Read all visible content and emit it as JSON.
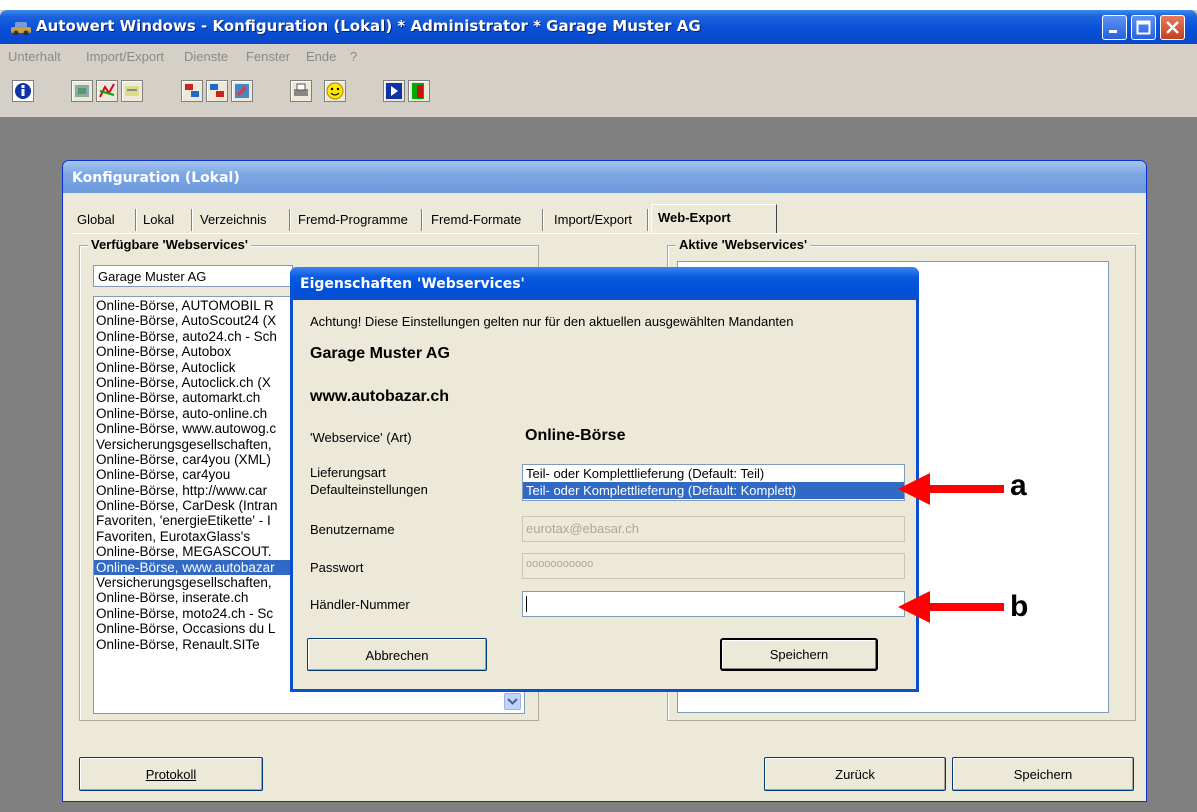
{
  "app": {
    "title": "Autowert Windows - Konfiguration (Lokal) * Administrator * Garage Muster AG",
    "menu": [
      "Unterhalt",
      "Import/Export",
      "Dienste",
      "Fenster",
      "Ende",
      "?"
    ]
  },
  "config_window": {
    "title": "Konfiguration (Lokal)",
    "tabs": [
      "Global",
      "Lokal",
      "Verzeichnis",
      "Fremd-Programme",
      "Fremd-Formate",
      "Import/Export",
      "Web-Export"
    ],
    "active_tab": "Web-Export",
    "available_group": {
      "legend": "Verfügbare 'Webservices'",
      "combo_value": "Garage Muster AG",
      "items": [
        "Online-Börse, AUTOMOBIL R",
        "Online-Börse, AutoScout24 (X",
        "Online-Börse, auto24.ch - Sch",
        "Online-Börse, Autobox",
        "Online-Börse, Autoclick",
        "Online-Börse, Autoclick.ch (X",
        "Online-Börse, automarkt.ch",
        "Online-Börse, auto-online.ch",
        "Online-Börse, www.autowog.c",
        "Versicherungsgesellschaften,",
        "Online-Börse, car4you (XML)",
        "Online-Börse, car4you",
        "Online-Börse, http://www.car",
        "Online-Börse, CarDesk (Intran",
        "Favoriten, 'energieEtikette' - I",
        "Favoriten, EurotaxGlass's",
        "Online-Börse, MEGASCOUT.",
        "Online-Börse, www.autobazar",
        "Versicherungsgesellschaften,",
        "Online-Börse, inserate.ch",
        "Online-Börse, moto24.ch - Sc",
        "Online-Börse, Occasions du L",
        "Online-Börse, Renault.SITe"
      ],
      "selected_index": 17
    },
    "active_group": {
      "legend": "Aktive 'Webservices'"
    },
    "buttons": {
      "protokoll": "Protokoll",
      "zurueck": "Zurück",
      "speichern": "Speichern"
    }
  },
  "dialog": {
    "title": "Eigenschaften 'Webservices'",
    "notice": "Achtung! Diese Einstellungen gelten nur für den aktuellen ausgewählten Mandanten",
    "company": "Garage Muster AG",
    "service_url": "www.autobazar.ch",
    "type_label": "'Webservice' (Art)",
    "type_value": "Online-Börse",
    "delivery_label_1": "Lieferungsart",
    "delivery_label_2": "Defaulteinstellungen",
    "delivery_options": [
      "Teil- oder Komplettlieferung (Default: Teil)",
      "Teil- oder Komplettlieferung (Default: Komplett)"
    ],
    "delivery_selected_index": 1,
    "username_label": "Benutzername",
    "username_value": "eurotax@ebasar.ch",
    "password_label": "Passwort",
    "password_value": "ooooooooooo",
    "dealer_label": "Händler-Nummer",
    "dealer_value": "",
    "cancel_button": "Abbrechen",
    "save_button": "Speichern"
  },
  "annotations": {
    "a": "a",
    "b": "b"
  },
  "colors": {
    "annotation_arrow": "#ff0000",
    "selection": "#316ac5",
    "xp_titlebar": "#0a50d8"
  }
}
